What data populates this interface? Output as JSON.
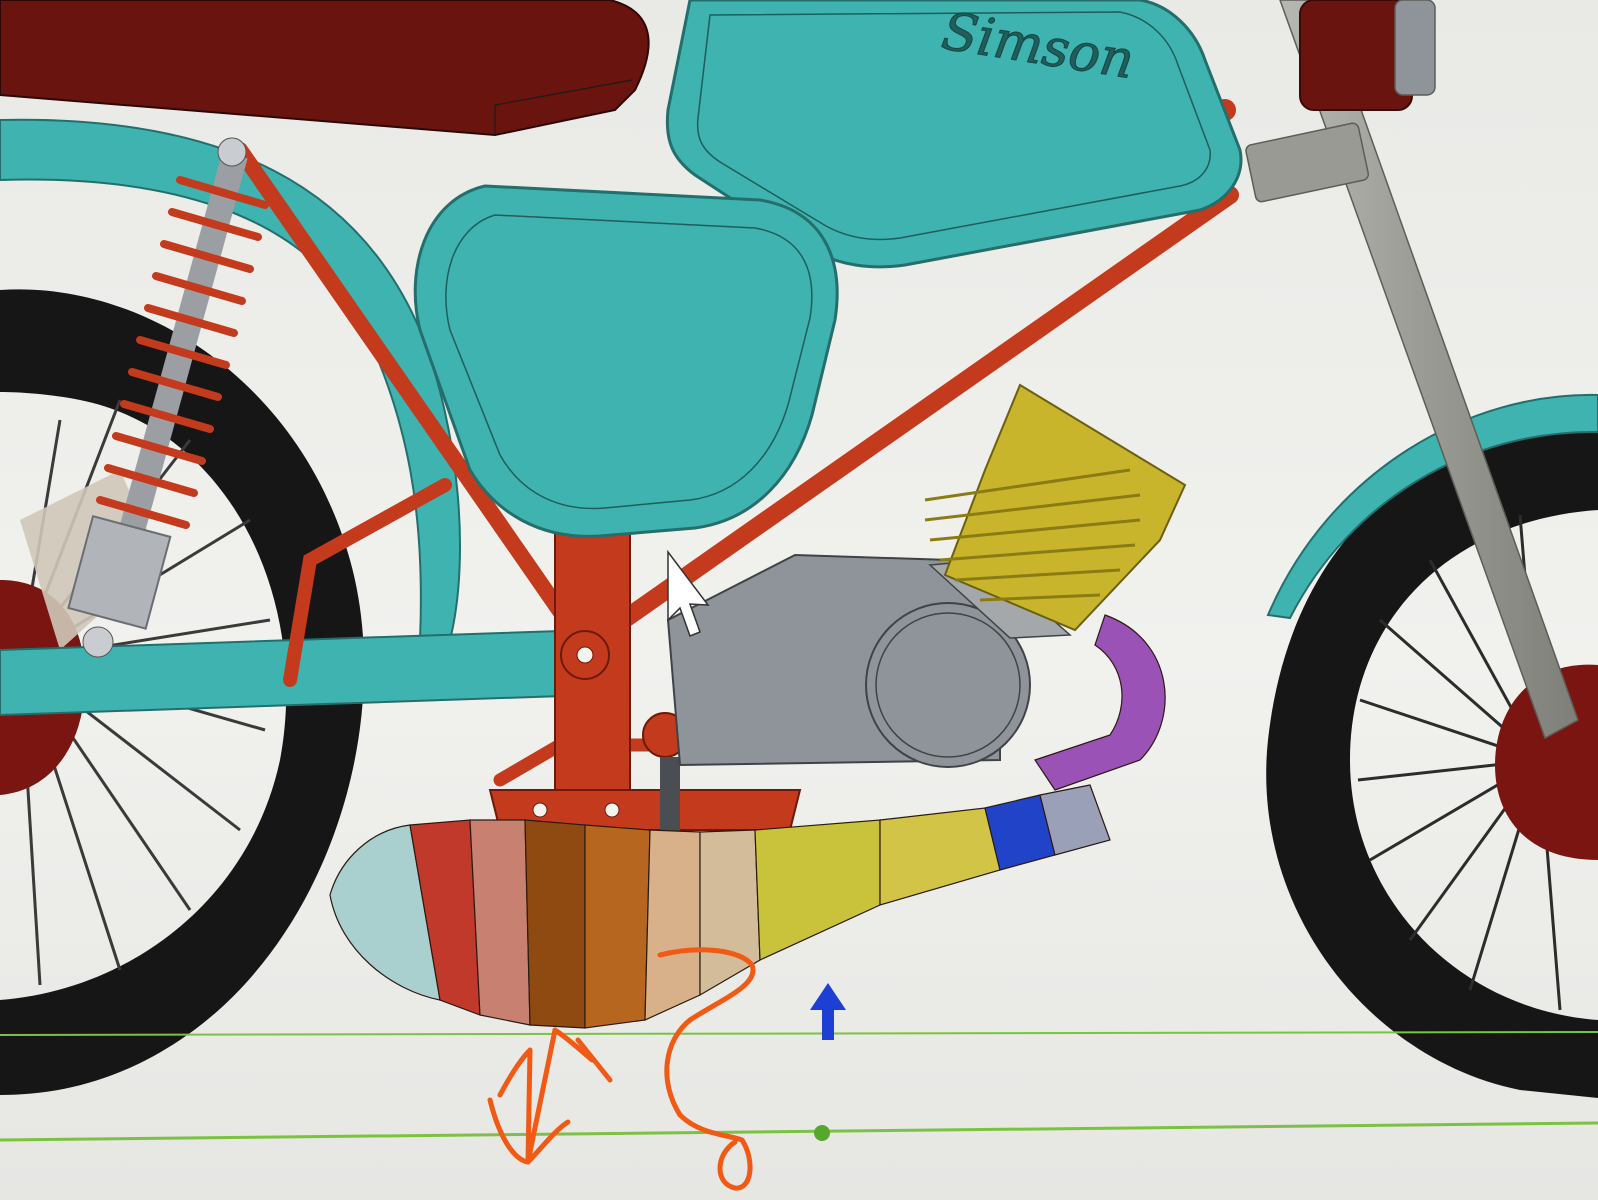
{
  "model": {
    "brand_label": "Simson"
  },
  "colors": {
    "frame_red": "#c43a1c",
    "tank_teal": "#3fb3b0",
    "tank_teal_dark": "#2f8f8d",
    "seat_maroon": "#6a1410",
    "engine_gray": "#8e9499",
    "cylinder_yellow": "#c8b52c",
    "fork_gray": "#9a9a94",
    "tire_black": "#161616",
    "ground_line_green": "#7cc242",
    "annotation_orange": "#f05a14",
    "axis_arrow_blue": "#1d3fd4"
  },
  "viewport": {
    "tool_cursor": "arrow-cursor-icon",
    "axis_indicator": "up-arrow-icon",
    "ground_planes": 2
  }
}
